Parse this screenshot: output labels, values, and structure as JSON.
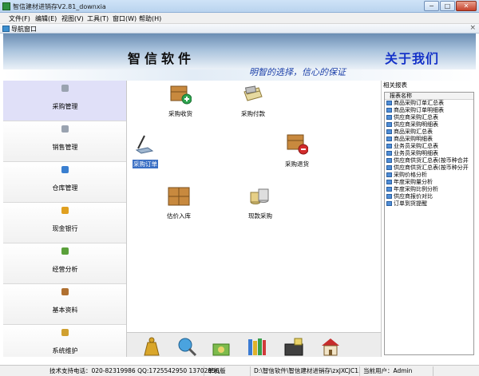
{
  "window": {
    "title": "智信建材进销存V2.81_downxia",
    "minimize": "−",
    "maximize": "□",
    "close": "✕"
  },
  "menu": [
    "文件(F)",
    "编辑(E)",
    "视图(V)",
    "工具(T)",
    "窗口(W)",
    "帮助(H)"
  ],
  "nav": {
    "label": "导航窗口",
    "close": "×"
  },
  "banner": {
    "company": "智信软件",
    "slogan": "明智的选择，信心的保证",
    "about": "关于我们"
  },
  "sidebar": [
    {
      "label": "采购管理",
      "icon": "purchase-icon",
      "color": "#9aa3b0"
    },
    {
      "label": "销售管理",
      "icon": "sales-icon",
      "color": "#9aa3b0"
    },
    {
      "label": "仓库管理",
      "icon": "warehouse-icon",
      "color": "#3a7fd0"
    },
    {
      "label": "现金银行",
      "icon": "cash-icon",
      "color": "#e0a020"
    },
    {
      "label": "经营分析",
      "icon": "analysis-icon",
      "color": "#5aa03a"
    },
    {
      "label": "基本资料",
      "icon": "basic-data-icon",
      "color": "#b07030"
    },
    {
      "label": "系统维护",
      "icon": "system-icon",
      "color": "#d0a030"
    }
  ],
  "functions": [
    {
      "label": "采购收货",
      "icon": "receive-goods-icon"
    },
    {
      "label": "采购付款",
      "icon": "payment-icon"
    },
    {
      "label": "采购订单",
      "icon": "purchase-order-icon"
    },
    {
      "label": "采购退货",
      "icon": "return-goods-icon"
    },
    {
      "label": "估价入库",
      "icon": "estimate-stock-icon"
    },
    {
      "label": "现款采购",
      "icon": "cash-purchase-icon"
    }
  ],
  "bottom_icons": [
    "money-bag-icon",
    "search-globe-icon",
    "money-icon",
    "books-icon",
    "sales-register-icon",
    "shop-icon"
  ],
  "reports": {
    "title": "相关报表",
    "header": "报表名称",
    "items": [
      "商品采购订单汇总表",
      "商品采购订单明细表",
      "供应商采购汇总表",
      "供应商采购明细表",
      "商品采购汇总表",
      "商品采购明细表",
      "业务员采购汇总表",
      "业务员采购明细表",
      "供应商供货汇总表(按币种合并",
      "供应商供货汇总表(按币种分开",
      "采购价格分析",
      "年度采购量分析",
      "年度采购比例分析",
      "供应商报价对比",
      "订单到货提醒"
    ]
  },
  "status": {
    "support": "技术支持电话：020-82319986 QQ:1725542950 13702856",
    "mode": "单机版",
    "path": "D:\\智信软件\\智信建材进销存\\zxJXCJC1.sys",
    "user": "当前用户：Admin"
  }
}
